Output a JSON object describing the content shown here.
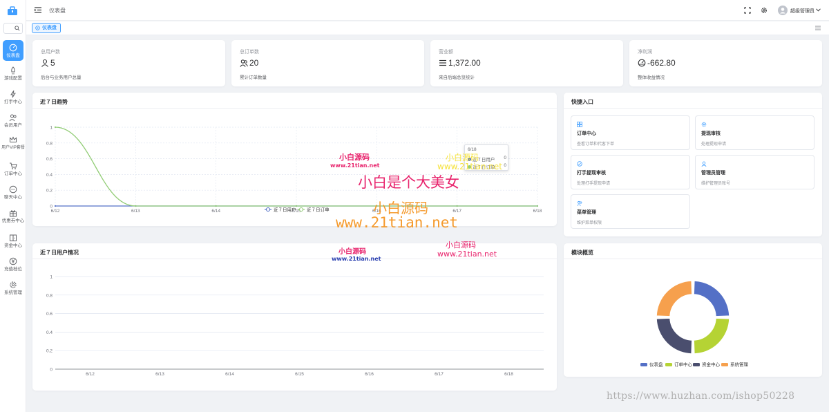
{
  "header": {
    "breadcrumb": "仪表盘",
    "user_name": "超级管理员"
  },
  "tags": {
    "active_tag": "仪表盘"
  },
  "sidebar": {
    "items": [
      {
        "label": "仪表盘",
        "icon": "dashboard-icon",
        "active": true
      },
      {
        "label": "游戏配置",
        "icon": "rocket-icon"
      },
      {
        "label": "打手中心",
        "icon": "lightning-icon"
      },
      {
        "label": "会员用户",
        "icon": "users-icon"
      },
      {
        "label": "用户VIP套餐",
        "icon": "crown-icon"
      },
      {
        "label": "订单中心",
        "icon": "cart-icon"
      },
      {
        "label": "聊天中心",
        "icon": "chat-icon"
      },
      {
        "label": "优惠券中心",
        "icon": "gift-icon"
      },
      {
        "label": "资金中心",
        "icon": "wallet-icon"
      },
      {
        "label": "充值档位",
        "icon": "yen-icon"
      },
      {
        "label": "系统管理",
        "icon": "gear-icon"
      }
    ]
  },
  "stats": [
    {
      "title": "总用户数",
      "value": "5",
      "desc": "后台与业务用户总量",
      "icon": "user-icon"
    },
    {
      "title": "总订单数",
      "value": "20",
      "desc": "累计订单数量",
      "icon": "users-icon"
    },
    {
      "title": "营业额",
      "value": "1,372.00",
      "desc": "来自后端总览统计",
      "icon": "menu-icon"
    },
    {
      "title": "净利润",
      "value": "-662.80",
      "desc": "整体收益情况",
      "icon": "gauge-icon"
    }
  ],
  "trend": {
    "title": "近７日趋势",
    "tooltip": {
      "date": "6/18",
      "rows": [
        {
          "label": "近７日用户",
          "value": "0"
        },
        {
          "label": "近７日订单",
          "value": "0"
        }
      ]
    }
  },
  "users_panel": {
    "title": "近７日用户情况"
  },
  "quick": {
    "title": "快捷入口",
    "items": [
      {
        "title": "订单中心",
        "desc": "查看订单和代客下单",
        "icon": "grid-icon"
      },
      {
        "title": "提现审核",
        "desc": "处理提现申请",
        "icon": "gear-icon"
      },
      {
        "title": "打手提现审核",
        "desc": "处理打手提现申请",
        "icon": "check-circle-icon"
      },
      {
        "title": "管理员管理",
        "desc": "维护管理员账号",
        "icon": "user-icon"
      },
      {
        "title": "菜单管理",
        "desc": "维护菜单权限",
        "icon": "users-icon"
      }
    ]
  },
  "overview": {
    "title": "模块概览"
  },
  "chart_data": [
    {
      "type": "line",
      "title": "近７日趋势",
      "x": [
        "6/12",
        "6/13",
        "6/14",
        "6/15",
        "6/16",
        "6/17",
        "6/18"
      ],
      "ylim": [
        0,
        1
      ],
      "yticks": [
        0,
        0.2,
        0.4,
        0.6,
        0.8,
        1
      ],
      "series": [
        {
          "name": "近７日用户",
          "values": [
            0,
            0,
            0,
            0,
            0,
            0,
            0
          ],
          "color": "#5470c6"
        },
        {
          "name": "近７日订单",
          "values": [
            1,
            0,
            0,
            0,
            0,
            0,
            0
          ],
          "color": "#91cc75"
        }
      ],
      "legend": "bottom-center"
    },
    {
      "type": "bar",
      "title": "近７日用户情况",
      "categories": [
        "6/12",
        "6/13",
        "6/14",
        "6/15",
        "6/16",
        "6/17",
        "6/18"
      ],
      "values": [
        0,
        0,
        0,
        0,
        0,
        0,
        0
      ],
      "ylim": [
        0,
        1
      ],
      "yticks": [
        0,
        0.2,
        0.4,
        0.6,
        0.8,
        1
      ]
    },
    {
      "type": "pie",
      "title": "模块概览",
      "labels": [
        "仪表盘",
        "订单中心",
        "资金中心",
        "系统管理"
      ],
      "values": [
        1,
        1,
        1,
        1
      ],
      "colors": [
        "#5470c6",
        "#b5d334",
        "#4a4e6e",
        "#f6a04d"
      ],
      "legend": "bottom"
    }
  ],
  "watermarks": {
    "a1": "小白源码",
    "a2": "www.21tian.net",
    "b1": "小白是个大美女",
    "c1": "小白源码",
    "c2": "www.21tian.net",
    "d1": "小白源码",
    "d2": "www.21tian.net",
    "e1": "小白源码",
    "e2": "www.21tian.net",
    "f1": "小白源码",
    "f2": "www.21tian.net",
    "footer": "https://www.huzhan.com/ishop50228"
  }
}
